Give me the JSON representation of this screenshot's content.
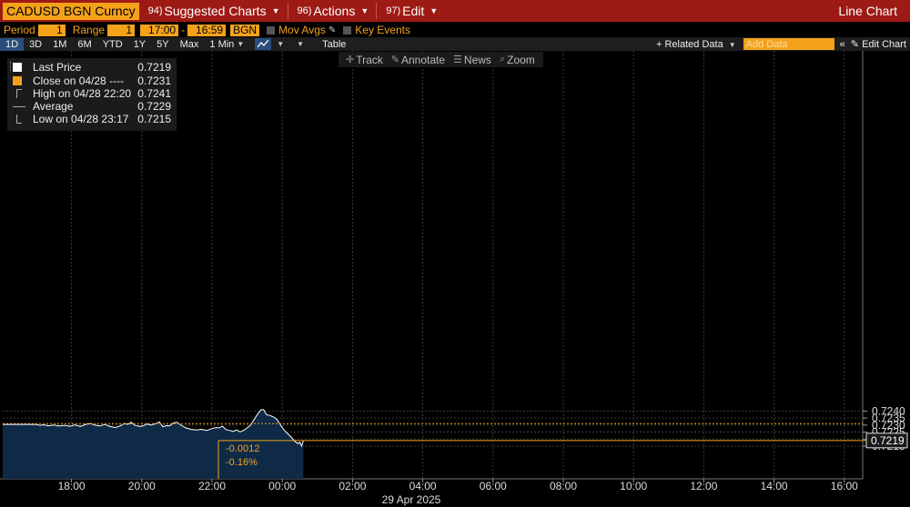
{
  "titlebar": {
    "ticker": "CADUSD BGN Curncy",
    "menus": [
      {
        "num": "94)",
        "label": "Suggested Charts"
      },
      {
        "num": "96)",
        "label": "Actions"
      },
      {
        "num": "97)",
        "label": "Edit"
      }
    ],
    "chart_kind": "Line Chart"
  },
  "settings": {
    "period_label": "Period",
    "period_value": "1",
    "range_label": "Range",
    "range_value": "1",
    "start_time": "17:00",
    "dash": "-",
    "end_time": "16:59",
    "source": "BGN",
    "mov_avgs": "Mov Avgs",
    "key_events": "Key Events"
  },
  "toolbar": {
    "periods": [
      "1D",
      "3D",
      "1M",
      "6M",
      "YTD",
      "1Y",
      "5Y",
      "Max"
    ],
    "active_period": "1D",
    "interval": "1 Min",
    "table": "Table",
    "related_data": "+ Related Data",
    "add_data_placeholder": "Add Data",
    "collapse": "«",
    "edit_chart": "Edit Chart"
  },
  "tools": [
    {
      "icon": "crosshair-icon",
      "glyph": "✛",
      "label": "Track"
    },
    {
      "icon": "annotate-icon",
      "glyph": "✎",
      "label": "Annotate"
    },
    {
      "icon": "news-icon",
      "glyph": "☰",
      "label": "News"
    },
    {
      "icon": "zoom-icon",
      "glyph": "⌕",
      "label": "Zoom"
    }
  ],
  "legend": [
    {
      "label": "Last Price",
      "value": "0.7219",
      "color": "#ffffff",
      "kind": "square"
    },
    {
      "label": "Close on 04/28 ----",
      "value": "0.7231",
      "color": "#f3a21a",
      "kind": "square"
    },
    {
      "label": "High on 04/28 22:20",
      "value": "0.7241",
      "color": "#aaaaaa",
      "kind": "tick-top"
    },
    {
      "label": "Average",
      "value": "0.7229",
      "color": "#aaaaaa",
      "kind": "dot-line"
    },
    {
      "label": "Low on 04/28 23:17",
      "value": "0.7215",
      "color": "#aaaaaa",
      "kind": "tick-bottom"
    }
  ],
  "colors": {
    "area_fill": "#0f2a47",
    "line": "#ffffff",
    "close_line": "#f3a21a",
    "grid": "#3a3a3a",
    "accent": "#f3a21a",
    "titlebar": "#9e1a14"
  },
  "chart_data": {
    "type": "area",
    "x_unit": "hours from 17:00 04/28",
    "y_ticks": [
      "0.7240",
      "0.7235",
      "0.7230",
      "0.7225",
      "0.7220",
      "0.7215"
    ],
    "ylim": [
      0.72125,
      0.72435
    ],
    "x_tick_labels": [
      "18:00",
      "20:00",
      "22:00",
      "00:00",
      "02:00",
      "04:00",
      "06:00",
      "08:00",
      "10:00",
      "12:00",
      "14:00",
      "16:00"
    ],
    "date_label": "29 Apr 2025",
    "close_value": 0.7231,
    "last_value": 0.7219,
    "last_label": "0.7219",
    "change_abs": "-0.0012",
    "change_pct": "-0.16%",
    "series": [
      {
        "values": [
          [
            0.0,
            0.72305
          ],
          [
            0.1,
            0.72298
          ],
          [
            0.2,
            0.72302
          ],
          [
            0.35,
            0.72295
          ],
          [
            0.5,
            0.723
          ],
          [
            0.65,
            0.72293
          ],
          [
            0.8,
            0.72298
          ],
          [
            0.95,
            0.72292
          ],
          [
            1.1,
            0.72301
          ],
          [
            1.25,
            0.7229
          ],
          [
            1.4,
            0.72305
          ],
          [
            1.55,
            0.72312
          ],
          [
            1.65,
            0.723
          ],
          [
            1.8,
            0.72294
          ],
          [
            1.95,
            0.72305
          ],
          [
            2.1,
            0.72289
          ],
          [
            2.25,
            0.72283
          ],
          [
            2.4,
            0.72295
          ],
          [
            2.5,
            0.72312
          ],
          [
            2.6,
            0.72305
          ],
          [
            2.7,
            0.7232
          ],
          [
            2.8,
            0.72298
          ],
          [
            2.95,
            0.7229
          ],
          [
            3.05,
            0.72296
          ],
          [
            3.15,
            0.72308
          ],
          [
            3.25,
            0.723
          ],
          [
            3.4,
            0.7231
          ],
          [
            3.5,
            0.72322
          ],
          [
            3.6,
            0.72288
          ],
          [
            3.7,
            0.72296
          ],
          [
            3.8,
            0.72295
          ],
          [
            3.9,
            0.72315
          ],
          [
            4.0,
            0.7232
          ],
          [
            4.1,
            0.72302
          ],
          [
            4.25,
            0.7228
          ],
          [
            4.4,
            0.7227
          ],
          [
            4.55,
            0.72265
          ],
          [
            4.7,
            0.7227
          ],
          [
            4.85,
            0.72262
          ],
          [
            5.0,
            0.72275
          ],
          [
            5.1,
            0.72282
          ],
          [
            5.2,
            0.7228
          ],
          [
            5.3,
            0.72292
          ],
          [
            5.4,
            0.72268
          ],
          [
            5.5,
            0.72262
          ],
          [
            5.6,
            0.72255
          ],
          [
            5.7,
            0.72265
          ],
          [
            5.8,
            0.72252
          ],
          [
            5.9,
            0.72262
          ],
          [
            6.0,
            0.7228
          ],
          [
            6.1,
            0.723
          ],
          [
            6.2,
            0.7234
          ],
          [
            6.3,
            0.7238
          ],
          [
            6.4,
            0.7241
          ],
          [
            6.47,
            0.7241
          ],
          [
            6.55,
            0.72375
          ],
          [
            6.65,
            0.72368
          ],
          [
            6.75,
            0.72358
          ],
          [
            6.85,
            0.7234
          ],
          [
            6.95,
            0.723
          ],
          [
            7.05,
            0.72265
          ],
          [
            7.15,
            0.7224
          ],
          [
            7.25,
            0.72215
          ],
          [
            7.35,
            0.72185
          ],
          [
            7.45,
            0.72168
          ],
          [
            7.5,
            0.72178
          ],
          [
            7.55,
            0.7215
          ],
          [
            7.6,
            0.7219
          ]
        ]
      }
    ]
  }
}
